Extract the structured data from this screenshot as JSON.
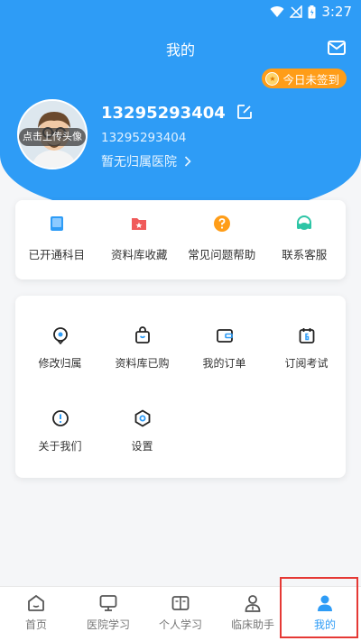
{
  "status": {
    "time": "3:27"
  },
  "header": {
    "title": "我的"
  },
  "signin": {
    "label": "今日未签到"
  },
  "profile": {
    "avatar_label": "点击上传头像",
    "name": "13295293404",
    "phone": "13295293404",
    "hospital": "暂无归属医院"
  },
  "quick": [
    {
      "label": "已开通科目",
      "icon": "book-icon",
      "color": "#2e9cf6"
    },
    {
      "label": "资料库收藏",
      "icon": "folder-star-icon",
      "color": "#f05a5a"
    },
    {
      "label": "常见问题帮助",
      "icon": "question-icon",
      "color": "#ff9d18"
    },
    {
      "label": "联系客服",
      "icon": "headset-icon",
      "color": "#2ec5a6"
    }
  ],
  "menu": [
    {
      "label": "修改归属",
      "icon": "location-icon"
    },
    {
      "label": "资料库已购",
      "icon": "bag-icon"
    },
    {
      "label": "我的订单",
      "icon": "wallet-icon"
    },
    {
      "label": "订阅考试",
      "icon": "calendar-icon"
    },
    {
      "label": "关于我们",
      "icon": "info-icon"
    },
    {
      "label": "设置",
      "icon": "settings-icon"
    }
  ],
  "tabs": [
    {
      "label": "首页",
      "icon": "home-icon"
    },
    {
      "label": "医院学习",
      "icon": "monitor-icon"
    },
    {
      "label": "个人学习",
      "icon": "open-book-icon"
    },
    {
      "label": "临床助手",
      "icon": "doctor-icon"
    },
    {
      "label": "我的",
      "icon": "user-icon",
      "active": true
    }
  ],
  "colors": {
    "primary": "#2e9cf6",
    "badge": "#ff9d18",
    "highlight": "#e53935"
  }
}
